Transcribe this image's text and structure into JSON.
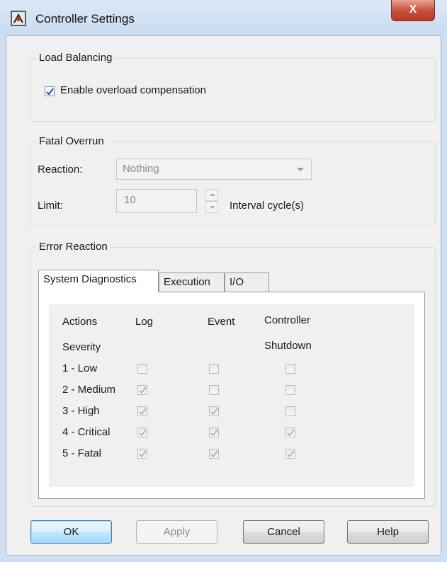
{
  "window": {
    "title": "Controller Settings",
    "close_label": "X"
  },
  "load_balancing": {
    "label": "Load Balancing",
    "overload_label": "Enable overload compensation",
    "overload_checked": true
  },
  "fatal_overrun": {
    "label": "Fatal Overrun",
    "reaction_label": "Reaction:",
    "reaction_value": "Nothing",
    "limit_label": "Limit:",
    "limit_value": "10",
    "limit_unit": "Interval cycle(s)"
  },
  "error_reaction": {
    "label": "Error Reaction",
    "tabs": [
      "System Diagnostics",
      "Execution",
      "I/O"
    ],
    "headers": {
      "actions": "Actions",
      "log": "Log",
      "event": "Event",
      "controller": "Controller",
      "severity": "Severity",
      "shutdown": "Shutdown"
    },
    "rows": [
      {
        "label": "1 - Low",
        "log": false,
        "event": false,
        "shutdown": false
      },
      {
        "label": "2 - Medium",
        "log": true,
        "event": false,
        "shutdown": false
      },
      {
        "label": "3 - High",
        "log": true,
        "event": true,
        "shutdown": false
      },
      {
        "label": "4 - Critical",
        "log": true,
        "event": true,
        "shutdown": true
      },
      {
        "label": "5 - Fatal",
        "log": true,
        "event": true,
        "shutdown": true
      }
    ]
  },
  "buttons": {
    "ok": "OK",
    "apply": "Apply",
    "cancel": "Cancel",
    "help": "Help"
  }
}
